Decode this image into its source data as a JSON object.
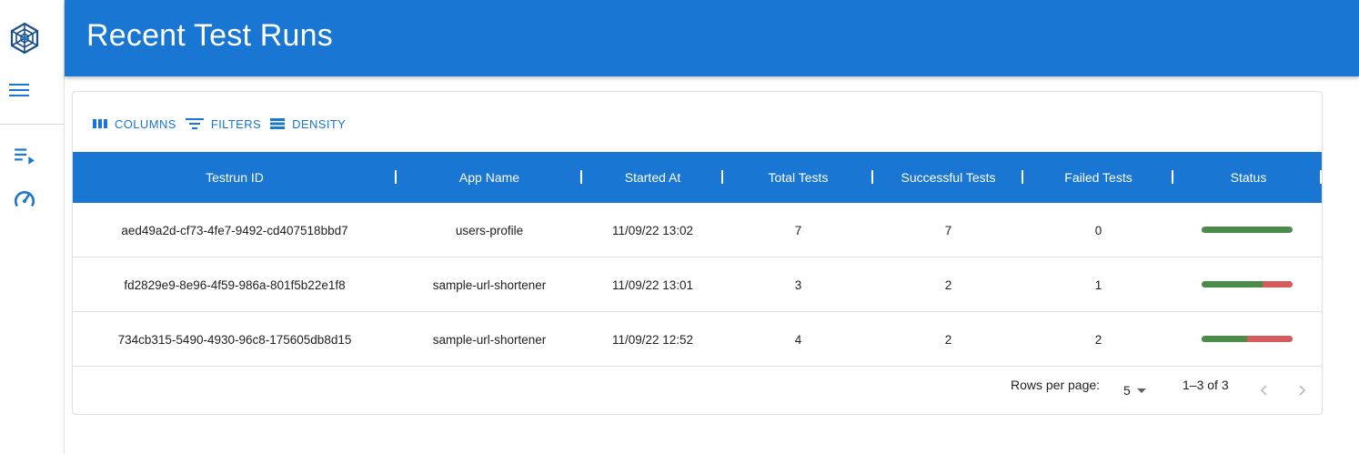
{
  "header": {
    "title": "Recent Test Runs"
  },
  "sidebar": {
    "logo_icon": "spider-web-logo-icon",
    "menu_icon": "hamburger-menu-icon",
    "items": [
      {
        "name": "test-runs",
        "icon": "playlist-play-icon"
      },
      {
        "name": "dashboard",
        "icon": "speedometer-icon"
      }
    ]
  },
  "toolbar": {
    "columns_label": "COLUMNS",
    "filters_label": "FILTERS",
    "density_label": "DENSITY"
  },
  "table": {
    "columns": [
      "Testrun ID",
      "App Name",
      "Started At",
      "Total Tests",
      "Successful Tests",
      "Failed Tests",
      "Status"
    ],
    "rows": [
      {
        "id": "aed49a2d-cf73-4fe7-9492-cd407518bbd7",
        "app": "users-profile",
        "started": "11/09/22 13:02",
        "total": "7",
        "success": "7",
        "failed": "0",
        "success_fraction": 1.0
      },
      {
        "id": "fd2829e9-8e96-4f59-986a-801f5b22e1f8",
        "app": "sample-url-shortener",
        "started": "11/09/22 13:01",
        "total": "3",
        "success": "2",
        "failed": "1",
        "success_fraction": 0.667
      },
      {
        "id": "734cb315-5490-4930-96c8-175605db8d15",
        "app": "sample-url-shortener",
        "started": "11/09/22 12:52",
        "total": "4",
        "success": "2",
        "failed": "2",
        "success_fraction": 0.5
      }
    ]
  },
  "pagination": {
    "rows_per_page_label": "Rows per page:",
    "rows_per_page_value": "5",
    "range_label": "1–3 of 3"
  },
  "colors": {
    "primary": "#1976d2",
    "success": "#4c8c4a",
    "failure": "#d45c5c"
  }
}
